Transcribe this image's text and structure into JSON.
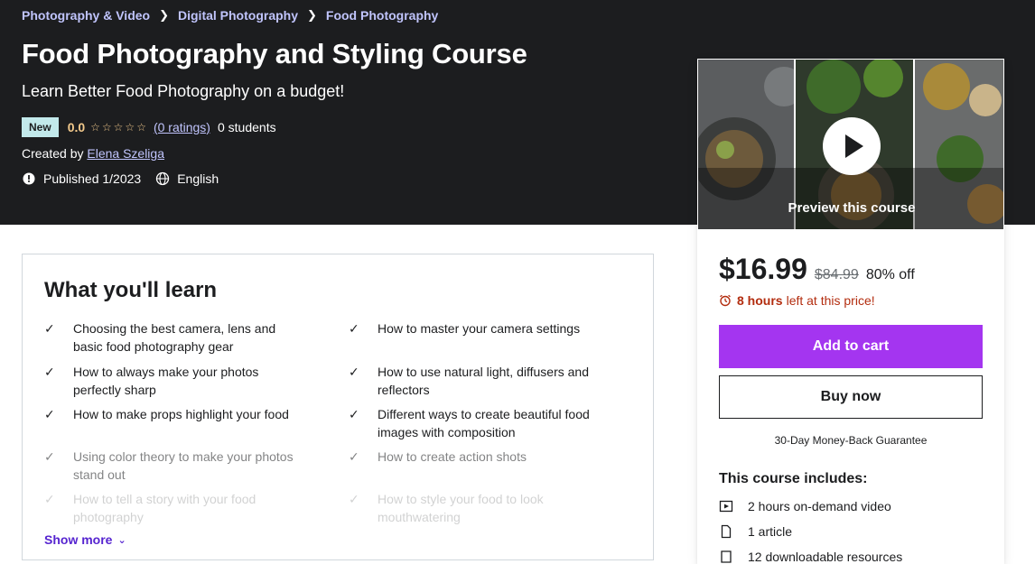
{
  "breadcrumb": [
    "Photography & Video",
    "Digital Photography",
    "Food Photography"
  ],
  "course": {
    "title": "Food Photography and Styling Course",
    "subtitle": "Learn Better Food Photography on a budget!",
    "badge": "New",
    "rating": "0.0",
    "stars": "☆☆☆☆☆",
    "ratings_link": "(0 ratings)",
    "students": "0 students",
    "created_by_label": "Created by",
    "instructor": "Elena Szeliga",
    "published": "Published 1/2023",
    "language": "English"
  },
  "learn": {
    "title": "What you'll learn",
    "items_left": [
      "Choosing the best camera, lens and basic food photography gear",
      "How to always make your photos perfectly sharp",
      "How to make props highlight your food",
      "Using color theory to make your photos stand out",
      "How to tell a story with your food photography"
    ],
    "items_right": [
      "How to master your camera settings",
      "How to use natural light, diffusers and reflectors",
      "Different ways to create beautiful food images with composition",
      "How to create action shots",
      "How to style your food to look mouthwatering"
    ],
    "show_more": "Show more"
  },
  "sidebar": {
    "preview_label": "Preview this course",
    "price": "$16.99",
    "original_price": "$84.99",
    "discount": "80% off",
    "timer_bold": "8 hours",
    "timer_rest": "left at this price!",
    "add_to_cart": "Add to cart",
    "buy_now": "Buy now",
    "guarantee": "30-Day Money-Back Guarantee",
    "includes_title": "This course includes:",
    "includes": [
      "2 hours on-demand video",
      "1 article",
      "12 downloadable resources"
    ]
  },
  "colors": {
    "hero_bg": "#1c1d1f",
    "link_purple": "#c0c4fc",
    "cart_purple": "#a435f0",
    "star_gold": "#f3ca8c",
    "timer_red": "#b32d0f",
    "show_more": "#5624d0"
  }
}
